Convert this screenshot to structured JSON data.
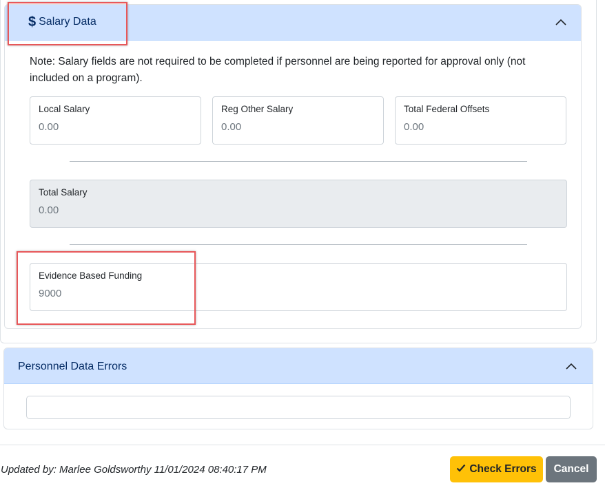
{
  "salary_section": {
    "title": "Salary Data",
    "icon": "dollar-icon",
    "note": "Note: Salary fields are not required to be completed if personnel are being reported for approval only (not included on a program).",
    "fields": {
      "local_salary": {
        "label": "Local Salary",
        "value": "0.00"
      },
      "reg_other_salary": {
        "label": "Reg Other Salary",
        "value": "0.00"
      },
      "total_federal_offsets": {
        "label": "Total Federal Offsets",
        "value": "0.00"
      },
      "total_salary": {
        "label": "Total Salary",
        "value": "0.00"
      },
      "evidence_based_funding": {
        "label": "Evidence Based Funding",
        "value": "9000"
      }
    }
  },
  "errors_section": {
    "title": "Personnel Data Errors",
    "value": ""
  },
  "footer": {
    "updated_by": "Updated by: Marlee Goldsworthy 11/01/2024 08:40:17 PM",
    "check_errors_label": "Check Errors",
    "cancel_label": "Cancel"
  },
  "colors": {
    "header_bg": "#cfe2ff",
    "header_text": "#052c65",
    "warning": "#ffc107",
    "secondary": "#6c757d",
    "highlight": "#e8585a"
  }
}
